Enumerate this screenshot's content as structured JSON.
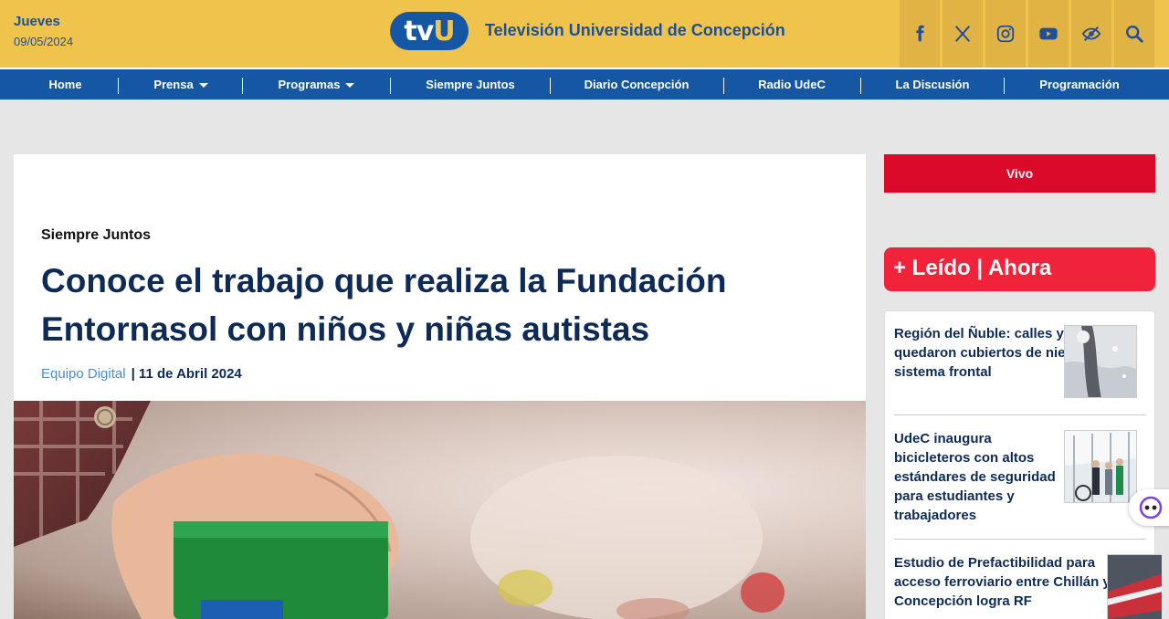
{
  "header": {
    "day": "Jueves",
    "date": "09/05/2024",
    "logo_text_tv": "tv",
    "logo_text_u": "U",
    "site_title": "Televisión Universidad de Concepción",
    "social": [
      "facebook-icon",
      "x-icon",
      "instagram-icon",
      "youtube-icon",
      "accessibility-icon",
      "search-icon"
    ]
  },
  "nav": {
    "items": [
      {
        "label": "Home"
      },
      {
        "label": "Prensa"
      },
      {
        "label": "Programas"
      },
      {
        "label": "Siempre Juntos"
      },
      {
        "label": "Diario Concepción"
      },
      {
        "label": "Radio UdeC"
      },
      {
        "label": "La Discusión"
      },
      {
        "label": "Programación"
      }
    ]
  },
  "article": {
    "category": "Siempre Juntos",
    "headline": "Conoce el trabajo que realiza la Fundación Entornasol con niños y niñas autistas",
    "author": "Equipo Digital",
    "date": "| 11 de Abril 2024"
  },
  "sidebar": {
    "live_label": "Vivo",
    "popular_header": "+ Leído | Ahora",
    "popular": [
      {
        "title": "Región del Ñuble: calles y árboles quedaron cubiertos de nieve tras sistema frontal"
      },
      {
        "title": "UdeC inaugura bicicleteros con altos estándares de seguridad para estudiantes y trabajadores"
      },
      {
        "title": "Estudio de Prefactibilidad para acceso ferroviario entre Chillán y Concepción logra RF"
      }
    ]
  },
  "colors": {
    "header_bg": "#f0c44c",
    "nav_bg": "#1657a4",
    "live_red": "#dc0a2a",
    "popular_red": "#f0233a",
    "headline_navy": "#0e2b57"
  }
}
